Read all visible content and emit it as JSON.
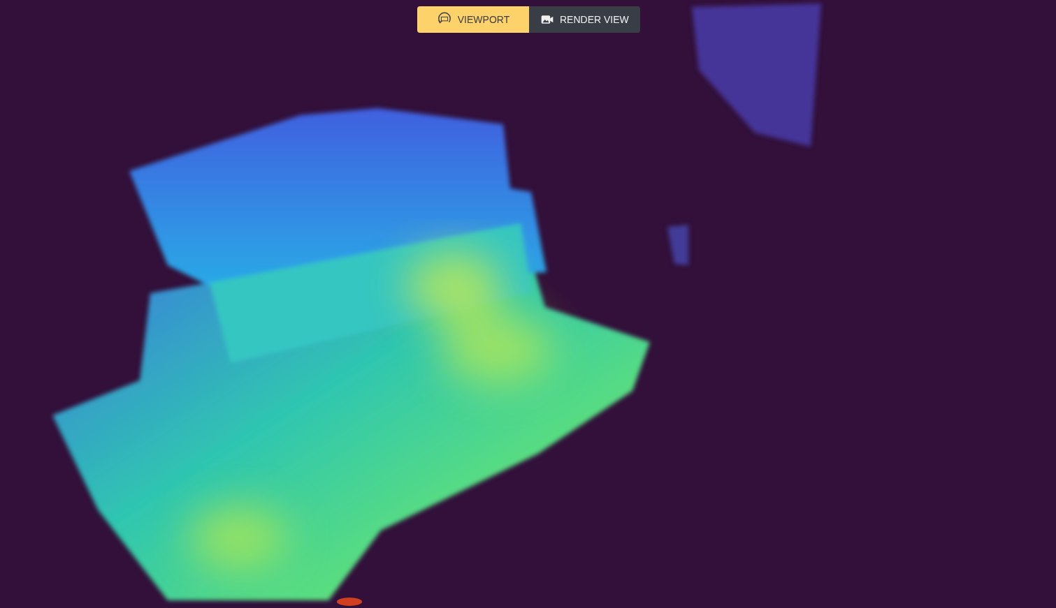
{
  "tabs": [
    {
      "label": "VIEWPORT",
      "selected": true
    },
    {
      "label": "RENDER VIEW",
      "selected": false
    }
  ]
}
